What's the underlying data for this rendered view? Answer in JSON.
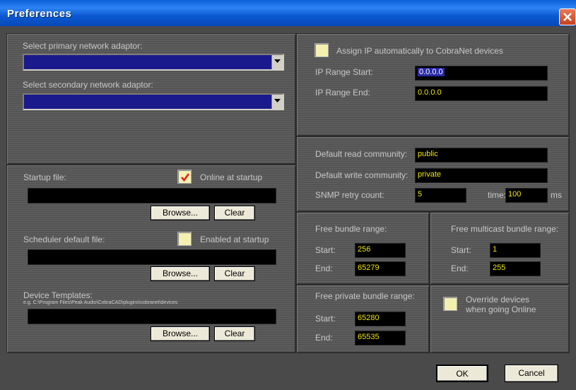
{
  "window": {
    "title": "Preferences"
  },
  "network": {
    "primary_label": "Select primary network adaptor:",
    "primary_value": "",
    "secondary_label": "Select secondary network adaptor:",
    "secondary_value": ""
  },
  "files": {
    "startup_label": "Startup file:",
    "online_startup_label": "Online at startup",
    "online_startup_checked": true,
    "startup_value": "",
    "browse1": "Browse...",
    "clear1": "Clear",
    "scheduler_label": "Scheduler default file:",
    "enabled_startup_label": "Enabled at startup",
    "enabled_startup_checked": false,
    "scheduler_value": "",
    "browse2": "Browse...",
    "clear2": "Clear",
    "templates_label": "Device Templates:",
    "templates_hint": "e.g. C:\\Program Files\\Peak Audio\\CobraCAD\\plugins\\cobranet\\devices",
    "templates_value": "",
    "browse3": "Browse...",
    "clear3": "Clear"
  },
  "ip": {
    "assign_label": "Assign IP automatically to CobraNet devices",
    "assign_checked": false,
    "range_start_label": "IP Range Start:",
    "range_start_value": "0.0.0.0",
    "range_end_label": "IP Range End:",
    "range_end_value": "0.0.0.0"
  },
  "snmp": {
    "read_label": "Default read community:",
    "read_value": "public",
    "write_label": "Default write community:",
    "write_value": "private",
    "retry_label": "SNMP retry count:",
    "retry_value": "5",
    "time_label": "time:",
    "time_value": "100",
    "ms_label": "ms"
  },
  "bundle": {
    "title": "Free bundle range:",
    "start_label": "Start:",
    "start_value": "256",
    "end_label": "End:",
    "end_value": "65279"
  },
  "multicast": {
    "title": "Free multicast bundle range:",
    "start_label": "Start:",
    "start_value": "1",
    "end_label": "End:",
    "end_value": "255"
  },
  "private": {
    "title": "Free private bundle range:",
    "start_label": "Start:",
    "start_value": "65280",
    "end_label": "End:",
    "end_value": "65535"
  },
  "override": {
    "label_line1": "Override devices",
    "label_line2": "when going Online",
    "checked": false
  },
  "footer": {
    "ok": "OK",
    "cancel": "Cancel"
  }
}
